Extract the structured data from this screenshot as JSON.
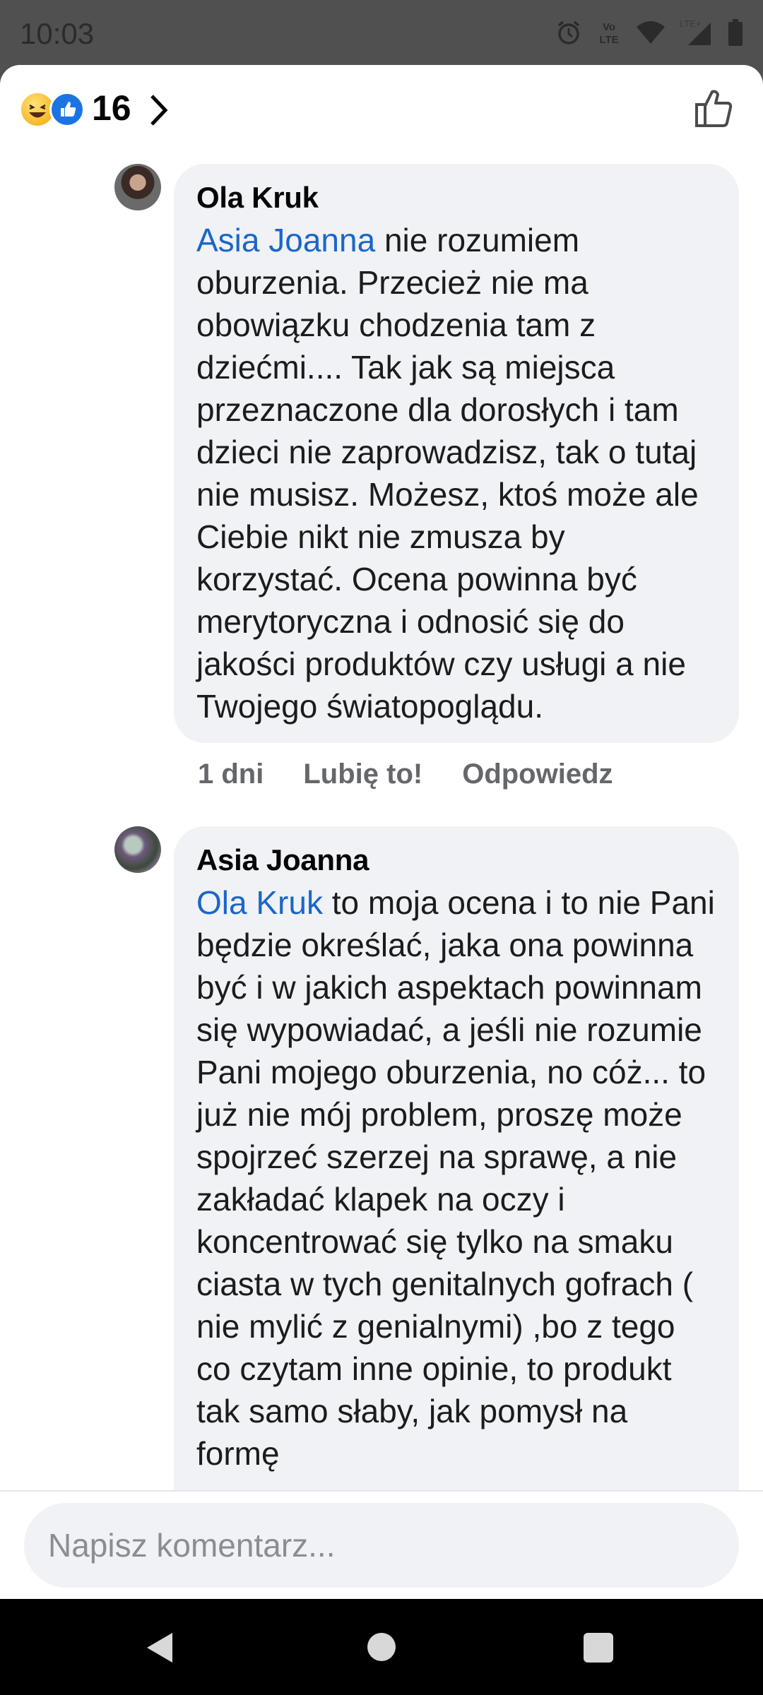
{
  "status_bar": {
    "time": "10:03",
    "icons": [
      "alarm-icon",
      "volte-icon",
      "wifi-icon",
      "lte-signal-icon",
      "battery-icon"
    ],
    "volte_label": "Vo LTE",
    "lte_label": "LTE+"
  },
  "reactions": {
    "emojis": [
      "haha-emoji-icon",
      "like-emoji-icon"
    ],
    "count": "16"
  },
  "comments": [
    {
      "author": "Ola Kruk",
      "mention": "Asia Joanna",
      "text": " nie rozumiem oburzenia. Przecież nie ma obowiązku chodzenia tam z dziećmi.... Tak jak są miejsca przeznaczone dla dorosłych i tam dzieci nie zaprowadzisz, tak o tutaj nie musisz. Możesz, ktoś może ale Ciebie nikt nie zmusza by korzystać. Ocena powinna być merytoryczna i odnosić się do jakości produktów czy usługi a nie Twojego światopoglądu.",
      "time": "1 dni",
      "like_label": "Lubię to!",
      "reply_label": "Odpowiedz"
    },
    {
      "author": "Asia Joanna",
      "mention": "Ola Kruk",
      "text": " to moja ocena i to nie Pani będzie określać, jaka ona powinna być i w jakich aspektach powinnam się wypowiadać, a jeśli nie rozumie Pani mojego oburzenia, no cóż... to już nie mój problem, proszę może spojrzeć szerzej na sprawę, a nie zakładać klapek na oczy i koncentrować się tylko na smaku ciasta w tych genitalnych gofrach ( nie mylić z genialnymi) ,bo z tego co czytam inne opinie, to produkt tak samo słaby, jak pomysł na formę"
    }
  ],
  "composer": {
    "placeholder": "Napisz komentarz..."
  },
  "colors": {
    "mention": "#1b66c9",
    "bubble": "#f0f2f5",
    "accent": "#1b74e4"
  }
}
